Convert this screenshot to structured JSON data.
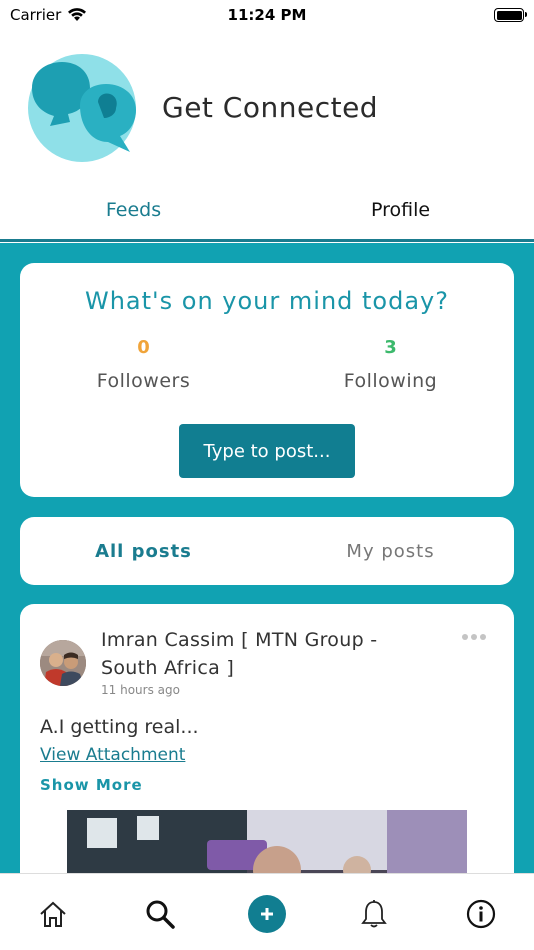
{
  "status_bar": {
    "carrier": "Carrier",
    "time": "11:24 PM"
  },
  "app": {
    "title": "Get Connected"
  },
  "tabs": {
    "feeds": "Feeds",
    "profile": "Profile"
  },
  "mind_card": {
    "title": "What's on your mind today?",
    "followers_count": "0",
    "followers_label": "Followers",
    "following_count": "3",
    "following_label": "Following",
    "post_button": "Type to post..."
  },
  "post_tabs": {
    "all": "All posts",
    "mine": "My posts"
  },
  "post": {
    "author": "Imran Cassim [ MTN Group - South Africa ]",
    "time": "11 hours ago",
    "text": "A.I getting real...",
    "attachment_link": "View Attachment",
    "show_more": "Show More"
  },
  "colors": {
    "brand": "#117e91",
    "background": "#11a2b2",
    "accent_text": "#1a95a8"
  },
  "bottom_nav": [
    "home-icon",
    "search-icon",
    "plus-icon",
    "bell-icon",
    "info-icon"
  ]
}
